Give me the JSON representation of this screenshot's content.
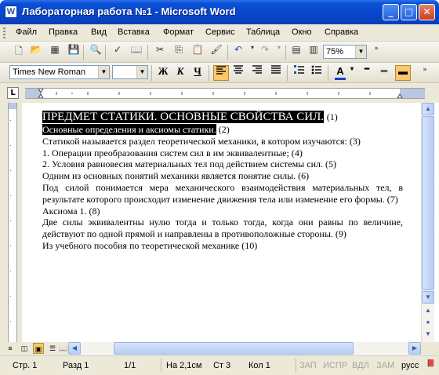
{
  "window": {
    "title": "Лабораторная работа №1 - Microsoft Word",
    "app_icon": "W",
    "buttons": {
      "minimize": "_",
      "maximize": "□",
      "close": "✕"
    }
  },
  "menu": {
    "items": [
      "Файл",
      "Правка",
      "Вид",
      "Вставка",
      "Формат",
      "Сервис",
      "Таблица",
      "Окно",
      "Справка"
    ]
  },
  "toolbar": {
    "zoom": "75%",
    "icons": [
      "new-document-icon",
      "open-folder-icon",
      "permission-icon",
      "save-icon",
      "print-preview-icon",
      "spelling-icon",
      "research-icon",
      "cut-icon",
      "copy-icon",
      "paste-icon",
      "format-painter-icon",
      "undo-icon",
      "redo-icon",
      "insert-table-icon",
      "columns-icon"
    ]
  },
  "formatting": {
    "font_name": "Times New Roman",
    "font_size": "",
    "bold": "Ж",
    "italic": "К",
    "underline": "Ч",
    "accent": "#ffc76a"
  },
  "document": {
    "heading": "ПРЕДМЕТ СТАТИКИ. ОСНОВНЫЕ СВОЙСТВА СИЛ.",
    "heading_suffix": "(1)",
    "subheading": "Основные определения и аксиомы статики.",
    "subheading_suffix": "(2)",
    "lines": [
      "Статикой называется раздел теоретической механики, в котором изучаются:  (3)",
      "1. Операции преобразования систем сил в им эквивалентные; (4)",
      "2. Условия равновесия материальных тел под действием системы сил. (5)",
      "Одним из основных понятий механики является понятие силы. (6)"
    ],
    "para1_line1": "Под силой понимается мера механического взаимодействия материальных тел, в",
    "para1_line2": "результате которого происходит изменение движения тела или изменение его формы. (7)",
    "axiom": "Аксиома 1. (8)",
    "para2_line1": "Две силы эквивалентны нулю тогда и только тогда, когда они равны по  величине,",
    "para2_line2": "действуют по одной прямой и направлены в противоположные стороны. (9)",
    "source": "Из учебного пособия по теоретической механике (10)"
  },
  "status": {
    "page": "Стр. 1",
    "section": "Разд 1",
    "pages": "1/1",
    "at": "На 2,1см",
    "line": "Ст 3",
    "col": "Кол 1",
    "rec": "ЗАП",
    "trk": "ИСПР",
    "ext": "ВДЛ",
    "ovr": "ЗАМ",
    "lang": "русс"
  }
}
